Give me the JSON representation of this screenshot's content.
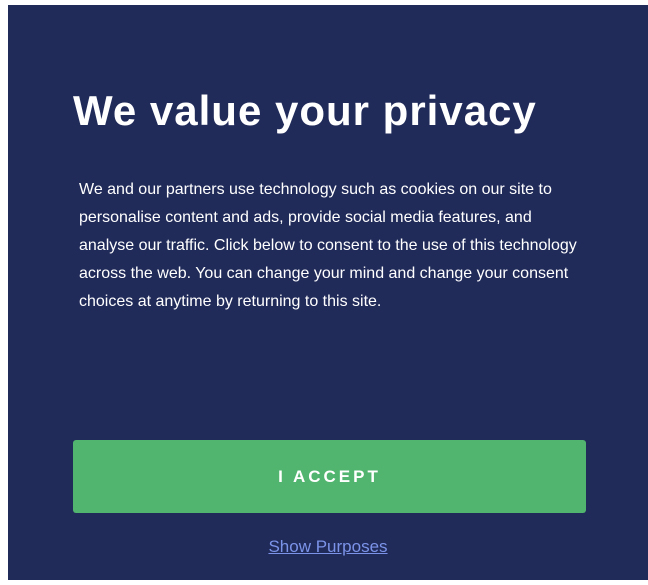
{
  "consent_dialog": {
    "title": "We value your privacy",
    "body": "We and our partners use technology such as cookies on our site to personalise content and ads, provide social media features, and analyse our traffic. Click below to consent to the use of this technology across the web. You can change your mind and change your consent choices at anytime by returning to this site.",
    "accept_label": "I ACCEPT",
    "show_purposes_label": "Show Purposes"
  },
  "colors": {
    "dialog_background": "#212b5a",
    "accept_button": "#52b56f",
    "link": "#7b93e8",
    "text": "#ffffff"
  }
}
